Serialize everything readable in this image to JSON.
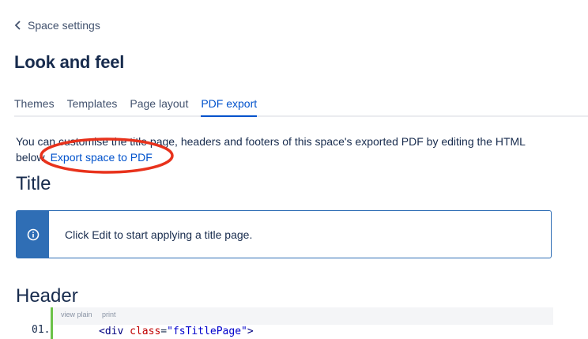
{
  "nav": {
    "back_label": "Space settings"
  },
  "page": {
    "title": "Look and feel"
  },
  "tabs": [
    {
      "label": "Themes"
    },
    {
      "label": "Templates"
    },
    {
      "label": "Page layout"
    },
    {
      "label": "PDF export"
    }
  ],
  "intro": {
    "text": "You can customise the title page, headers and footers of this space's exported PDF by editing the HTML below.",
    "link": "Export space to PDF"
  },
  "sections": {
    "title": "Title",
    "header": "Header"
  },
  "info": {
    "icon": "info-icon",
    "text": "Click Edit to start applying a title page."
  },
  "code": {
    "toolbar": [
      "view plain",
      "print"
    ],
    "line_number": "01.",
    "tag_open": "<div",
    "attr": "class",
    "equals": "=",
    "value": "\"fsTitlePage\"",
    "tag_close": ">"
  },
  "colors": {
    "accent": "#0052cc",
    "info": "#2f6eb5",
    "annotation": "#e8321c"
  }
}
